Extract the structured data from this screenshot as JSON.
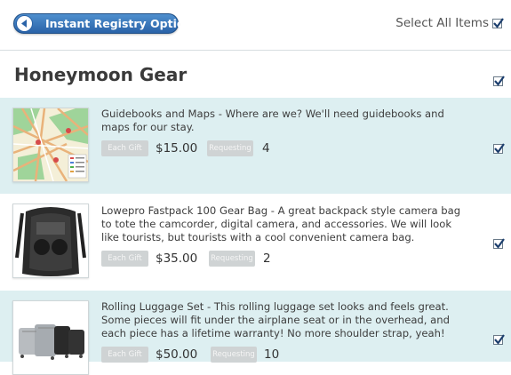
{
  "header": {
    "registry_button_label": "Instant Registry Options",
    "select_all_label": "Select All Items"
  },
  "section": {
    "title": "Honeymoon Gear"
  },
  "items": [
    {
      "description": "Guidebooks and Maps - Where are we? We'll need guidebooks and maps for our stay.",
      "each_gift_label": "Each Gift",
      "price": "$15.00",
      "requesting_label": "Requesting",
      "quantity": "4"
    },
    {
      "description": "Lowepro Fastpack 100 Gear Bag - A great backpack style camera bag to tote the camcorder, digital camera, and accessories. We will look like tourists, but tourists with a cool convenient camera bag.",
      "each_gift_label": "Each Gift",
      "price": "$35.00",
      "requesting_label": "Requesting",
      "quantity": "2"
    },
    {
      "description": "Rolling Luggage Set - This rolling luggage set looks and feels great. Some pieces will fit under the airplane seat or in the overhead, and each piece has a lifetime warranty! No more shoulder strap, yeah!",
      "each_gift_label": "Each Gift",
      "price": "$50.00",
      "requesting_label": "Requesting",
      "quantity": "10"
    }
  ],
  "colors": {
    "button_blue": "#2a63a8",
    "row_alt_bg": "#ddeff1",
    "checkmark": "#1d3f6e"
  }
}
